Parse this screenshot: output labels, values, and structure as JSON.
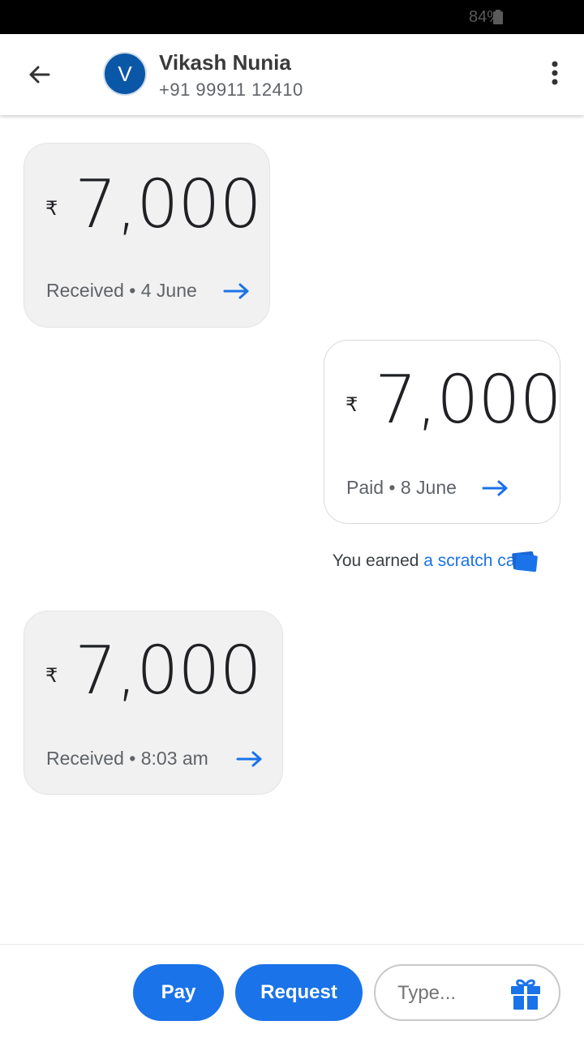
{
  "status_bar": {
    "battery": "84%"
  },
  "header": {
    "avatar_letter": "V",
    "name": "Vikash Nunia",
    "phone": "+91 99911 12410"
  },
  "messages": [
    {
      "type": "received",
      "currency": "₹",
      "amount": "7,000",
      "status": "Received • 4 June"
    },
    {
      "type": "paid",
      "currency": "₹",
      "amount": "7,000",
      "status": "Paid • 8 June"
    },
    {
      "type": "received",
      "currency": "₹",
      "amount": "7,000",
      "status": "Received • 8:03 am"
    }
  ],
  "scratch_note": {
    "prefix": "You earned ",
    "link": "a scratch card",
    "suffix": "!"
  },
  "bottom": {
    "pay_label": "Pay",
    "request_label": "Request",
    "type_placeholder": "Type..."
  },
  "colors": {
    "accent": "#1a73e8",
    "avatar": "#0b57a7"
  }
}
